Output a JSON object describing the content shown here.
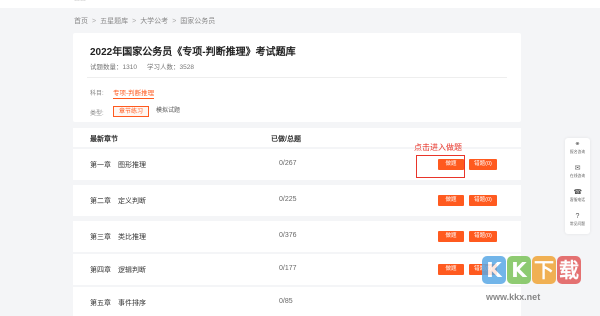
{
  "top_strip_text": "……",
  "breadcrumb": [
    "首页",
    "五星题库",
    "大学公考",
    "国家公务员"
  ],
  "exam": {
    "title": "2022年国家公务员《专项-判断推理》考试题库",
    "question_count": "试题数量：1310",
    "learner_count": "学习人数：3528"
  },
  "subject": {
    "label": "科目:",
    "value": "专项-判断推理"
  },
  "type": {
    "label": "类型:",
    "active": "章节练习",
    "other": "模拟试题"
  },
  "list_header": {
    "chapter": "最新章节",
    "done_total": "已做/总题"
  },
  "buttons": {
    "do": "做题",
    "wrong": "错题(0)"
  },
  "chapters": [
    {
      "num": "第一章",
      "name": "图形推理",
      "count": "0/267"
    },
    {
      "num": "第二章",
      "name": "定义判断",
      "count": "0/225"
    },
    {
      "num": "第三章",
      "name": "类比推理",
      "count": "0/376"
    },
    {
      "num": "第四章",
      "name": "逻辑判断",
      "count": "0/177"
    },
    {
      "num": "第五章",
      "name": "事件排序",
      "count": "0/85"
    }
  ],
  "annotation": "点击进入做题",
  "side_panel": [
    {
      "icon": "headset-icon",
      "label": "报名咨询"
    },
    {
      "icon": "chat-icon",
      "label": "在线咨询"
    },
    {
      "icon": "phone-icon",
      "label": "客服电话"
    },
    {
      "icon": "question-icon",
      "label": "常见问题"
    }
  ],
  "watermark": {
    "letters": [
      "K",
      "K",
      "下",
      "载"
    ],
    "url": "www.kkx.net"
  },
  "colors": {
    "accent": "#ff5a1f",
    "annotation": "#e8352a"
  }
}
